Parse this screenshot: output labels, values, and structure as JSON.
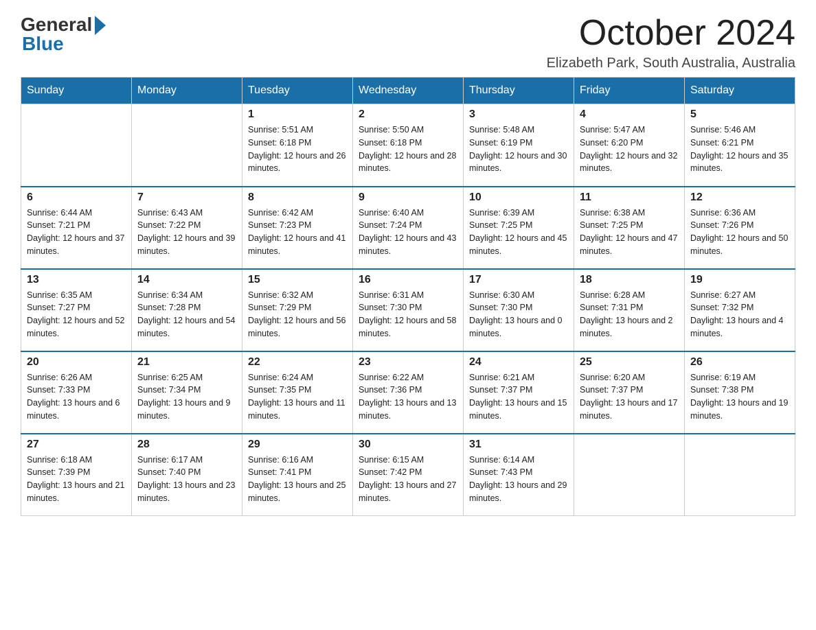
{
  "logo": {
    "general": "General",
    "blue": "Blue"
  },
  "title": "October 2024",
  "location": "Elizabeth Park, South Australia, Australia",
  "weekdays": [
    "Sunday",
    "Monday",
    "Tuesday",
    "Wednesday",
    "Thursday",
    "Friday",
    "Saturday"
  ],
  "weeks": [
    [
      null,
      null,
      {
        "day": 1,
        "sunrise": "5:51 AM",
        "sunset": "6:18 PM",
        "daylight": "12 hours and 26 minutes."
      },
      {
        "day": 2,
        "sunrise": "5:50 AM",
        "sunset": "6:18 PM",
        "daylight": "12 hours and 28 minutes."
      },
      {
        "day": 3,
        "sunrise": "5:48 AM",
        "sunset": "6:19 PM",
        "daylight": "12 hours and 30 minutes."
      },
      {
        "day": 4,
        "sunrise": "5:47 AM",
        "sunset": "6:20 PM",
        "daylight": "12 hours and 32 minutes."
      },
      {
        "day": 5,
        "sunrise": "5:46 AM",
        "sunset": "6:21 PM",
        "daylight": "12 hours and 35 minutes."
      }
    ],
    [
      {
        "day": 6,
        "sunrise": "6:44 AM",
        "sunset": "7:21 PM",
        "daylight": "12 hours and 37 minutes."
      },
      {
        "day": 7,
        "sunrise": "6:43 AM",
        "sunset": "7:22 PM",
        "daylight": "12 hours and 39 minutes."
      },
      {
        "day": 8,
        "sunrise": "6:42 AM",
        "sunset": "7:23 PM",
        "daylight": "12 hours and 41 minutes."
      },
      {
        "day": 9,
        "sunrise": "6:40 AM",
        "sunset": "7:24 PM",
        "daylight": "12 hours and 43 minutes."
      },
      {
        "day": 10,
        "sunrise": "6:39 AM",
        "sunset": "7:25 PM",
        "daylight": "12 hours and 45 minutes."
      },
      {
        "day": 11,
        "sunrise": "6:38 AM",
        "sunset": "7:25 PM",
        "daylight": "12 hours and 47 minutes."
      },
      {
        "day": 12,
        "sunrise": "6:36 AM",
        "sunset": "7:26 PM",
        "daylight": "12 hours and 50 minutes."
      }
    ],
    [
      {
        "day": 13,
        "sunrise": "6:35 AM",
        "sunset": "7:27 PM",
        "daylight": "12 hours and 52 minutes."
      },
      {
        "day": 14,
        "sunrise": "6:34 AM",
        "sunset": "7:28 PM",
        "daylight": "12 hours and 54 minutes."
      },
      {
        "day": 15,
        "sunrise": "6:32 AM",
        "sunset": "7:29 PM",
        "daylight": "12 hours and 56 minutes."
      },
      {
        "day": 16,
        "sunrise": "6:31 AM",
        "sunset": "7:30 PM",
        "daylight": "12 hours and 58 minutes."
      },
      {
        "day": 17,
        "sunrise": "6:30 AM",
        "sunset": "7:30 PM",
        "daylight": "13 hours and 0 minutes."
      },
      {
        "day": 18,
        "sunrise": "6:28 AM",
        "sunset": "7:31 PM",
        "daylight": "13 hours and 2 minutes."
      },
      {
        "day": 19,
        "sunrise": "6:27 AM",
        "sunset": "7:32 PM",
        "daylight": "13 hours and 4 minutes."
      }
    ],
    [
      {
        "day": 20,
        "sunrise": "6:26 AM",
        "sunset": "7:33 PM",
        "daylight": "13 hours and 6 minutes."
      },
      {
        "day": 21,
        "sunrise": "6:25 AM",
        "sunset": "7:34 PM",
        "daylight": "13 hours and 9 minutes."
      },
      {
        "day": 22,
        "sunrise": "6:24 AM",
        "sunset": "7:35 PM",
        "daylight": "13 hours and 11 minutes."
      },
      {
        "day": 23,
        "sunrise": "6:22 AM",
        "sunset": "7:36 PM",
        "daylight": "13 hours and 13 minutes."
      },
      {
        "day": 24,
        "sunrise": "6:21 AM",
        "sunset": "7:37 PM",
        "daylight": "13 hours and 15 minutes."
      },
      {
        "day": 25,
        "sunrise": "6:20 AM",
        "sunset": "7:37 PM",
        "daylight": "13 hours and 17 minutes."
      },
      {
        "day": 26,
        "sunrise": "6:19 AM",
        "sunset": "7:38 PM",
        "daylight": "13 hours and 19 minutes."
      }
    ],
    [
      {
        "day": 27,
        "sunrise": "6:18 AM",
        "sunset": "7:39 PM",
        "daylight": "13 hours and 21 minutes."
      },
      {
        "day": 28,
        "sunrise": "6:17 AM",
        "sunset": "7:40 PM",
        "daylight": "13 hours and 23 minutes."
      },
      {
        "day": 29,
        "sunrise": "6:16 AM",
        "sunset": "7:41 PM",
        "daylight": "13 hours and 25 minutes."
      },
      {
        "day": 30,
        "sunrise": "6:15 AM",
        "sunset": "7:42 PM",
        "daylight": "13 hours and 27 minutes."
      },
      {
        "day": 31,
        "sunrise": "6:14 AM",
        "sunset": "7:43 PM",
        "daylight": "13 hours and 29 minutes."
      },
      null,
      null
    ]
  ],
  "labels": {
    "sunrise": "Sunrise:",
    "sunset": "Sunset:",
    "daylight": "Daylight:"
  }
}
